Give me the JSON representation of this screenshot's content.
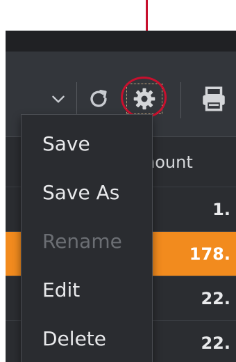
{
  "annotation": {
    "arrow_color": "#c8102e",
    "highlight_target": "settings-button"
  },
  "toolbar": {
    "icons": [
      "chevron-down-icon",
      "refresh-icon",
      "gear-icon",
      "printer-icon"
    ]
  },
  "table": {
    "header_label": "nount",
    "rows": [
      {
        "value": "1."
      },
      {
        "value": "178.",
        "highlighted": true
      },
      {
        "value": "22."
      },
      {
        "value": "22."
      }
    ],
    "highlight_color": "#f28b1e"
  },
  "menu": {
    "items": [
      {
        "label": "Save",
        "enabled": true
      },
      {
        "label": "Save As",
        "enabled": true
      },
      {
        "label": "Rename",
        "enabled": false
      },
      {
        "label": "Edit",
        "enabled": true
      },
      {
        "label": "Delete",
        "enabled": true
      }
    ]
  }
}
